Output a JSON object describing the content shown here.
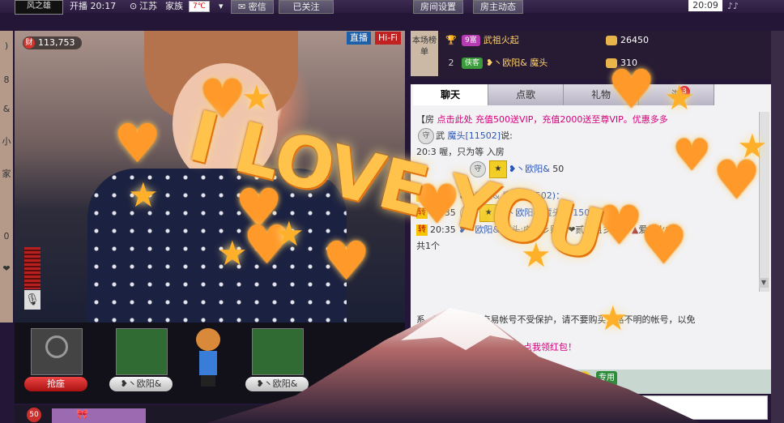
{
  "topbar": {
    "logo": "风之雄",
    "status": "开播 20:17",
    "location": "江苏",
    "ethnicity": "家族",
    "temperature": "7℃",
    "secret_label": "密信",
    "follow_label": "已关注",
    "room_settings": "房间设置",
    "host_news": "房主动态",
    "clock": "20:09"
  },
  "left_strip": {
    "items": [
      ")",
      "8",
      "&",
      "小",
      "家",
      "0",
      "❤"
    ]
  },
  "video": {
    "viewer_count": "113,753",
    "wealth_icon_label": "财",
    "live_label": "直播",
    "hifi_label": "Hi-Fi"
  },
  "leaderboard": {
    "label": "本场榜单",
    "rows": [
      {
        "rank": "1",
        "level": "9富",
        "name": "武祖火起",
        "score": "26450",
        "level_color": "#b43bb1"
      },
      {
        "rank": "2",
        "level": "侠客",
        "name": "❥丶欧阳& 魔头",
        "score": "310",
        "level_color": "#3b9a3b"
      }
    ]
  },
  "chat": {
    "tabs": [
      "聊天",
      "点歌",
      "礼物",
      "游"
    ],
    "tab_badge": "3",
    "announcement": "【房",
    "announcement_text": "点击此处 充值500送VIP，充值2000送至尊VIP。优惠多多",
    "lines": [
      {
        "prefix": "",
        "time": "",
        "text": "武",
        "name": "魔头[11502]",
        "tail": "说:"
      },
      {
        "prefix": "",
        "time": "20:3",
        "text": "喔，只为等",
        "name": "",
        "tail": "入房"
      },
      {
        "prefix": "",
        "time": "",
        "text": "",
        "name": "❥丶欧阳&",
        "tail": "50"
      },
      {
        "prefix": "转",
        "time": "20:34",
        "text": "",
        "name": "❥丶欧阳& 魔头(11502)：",
        "tail": ""
      },
      {
        "prefix": "转",
        "time": "20:35",
        "text": "",
        "name": "❥丶欧阳& 魔头 [11502]",
        "tail": "音"
      },
      {
        "prefix": "转",
        "time": "20:35",
        "text": "向『彡败家❤贰小姐彡』送",
        "name": "❥丶欧阳& 魔头:",
        "tail": "爱的火山,"
      },
      {
        "prefix": "",
        "time": "",
        "text": "共1个",
        "name": "",
        "tail": ""
      }
    ],
    "system_prefix": "系",
    "system_text": "【香场】私下交易帐号不受保护，请不要购买来路不明的帐号，以免",
    "promo_text": "富》在此恭贺您新年快乐！点我领红包！",
    "use_label": "专用"
  },
  "seats": {
    "grab_label": "抢座",
    "seat_labels": [
      "❥丶欧阳&",
      "❥丶欧阳&"
    ]
  },
  "bottom": {
    "badge_count": "50"
  },
  "overlay": {
    "love_text": "I LOVE YOU"
  }
}
